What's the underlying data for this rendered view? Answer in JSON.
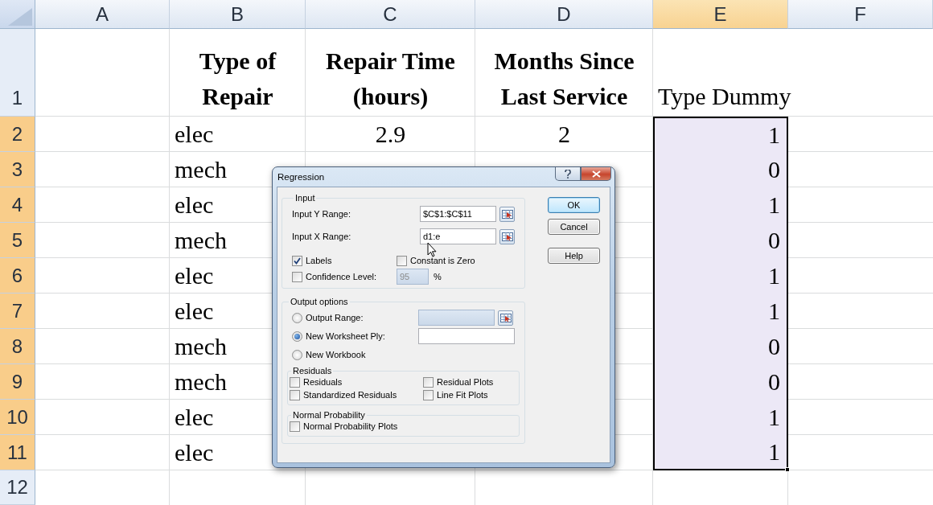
{
  "columns": [
    {
      "label": "A",
      "selected": false
    },
    {
      "label": "B",
      "selected": false
    },
    {
      "label": "C",
      "selected": false
    },
    {
      "label": "D",
      "selected": false
    },
    {
      "label": "E",
      "selected": true
    },
    {
      "label": "F",
      "selected": false
    }
  ],
  "rows": [
    {
      "number": "1",
      "selected": false,
      "kind": "heading",
      "b": "Type of\nRepair",
      "c": "Repair Time\n(hours)",
      "d": "Months Since\nLast Service",
      "e": "Type Dummy"
    },
    {
      "number": "2",
      "selected": true,
      "kind": "data",
      "b": "elec",
      "c": "2.9",
      "d": "2",
      "e": "1"
    },
    {
      "number": "3",
      "selected": true,
      "kind": "data",
      "b": "mech",
      "e": "0"
    },
    {
      "number": "4",
      "selected": true,
      "kind": "data",
      "b": "elec",
      "e": "1"
    },
    {
      "number": "5",
      "selected": true,
      "kind": "data",
      "b": "mech",
      "e": "0"
    },
    {
      "number": "6",
      "selected": true,
      "kind": "data",
      "b": "elec",
      "e": "1"
    },
    {
      "number": "7",
      "selected": true,
      "kind": "data",
      "b": "elec",
      "e": "1"
    },
    {
      "number": "8",
      "selected": true,
      "kind": "data",
      "b": "mech",
      "e": "0"
    },
    {
      "number": "9",
      "selected": true,
      "kind": "data",
      "b": "mech",
      "e": "0"
    },
    {
      "number": "10",
      "selected": true,
      "kind": "data",
      "b": "elec",
      "e": "1"
    },
    {
      "number": "11",
      "selected": true,
      "kind": "data",
      "b": "elec",
      "e": "1"
    },
    {
      "number": "12",
      "selected": false,
      "kind": "data"
    }
  ],
  "dialog": {
    "title": "Regression",
    "input_group": {
      "title": "Input",
      "ranges": [
        {
          "label": "Input Y Range:",
          "value": "$C$1:$C$11"
        },
        {
          "label": "Input X Range:",
          "value": "d1:e"
        }
      ],
      "labels": {
        "label": "Labels",
        "checked": true
      },
      "constant_is_zero": {
        "label": "Constant is Zero",
        "checked": false
      },
      "confidence": {
        "label": "Confidence Level:",
        "checked": false,
        "value": "95",
        "unit": "%",
        "disabled": true
      }
    },
    "output_group": {
      "title": "Output options",
      "destinations": [
        {
          "label": "Output Range:",
          "selected": false,
          "kind": "range",
          "field_disabled": true
        },
        {
          "label": "New Worksheet Ply:",
          "selected": true,
          "kind": "text",
          "field_disabled": false
        },
        {
          "label": "New Workbook",
          "selected": false,
          "kind": "plain"
        }
      ],
      "residuals": {
        "title": "Residuals",
        "options": [
          {
            "label": "Residuals",
            "checked": false
          },
          {
            "label": "Residual Plots",
            "checked": false
          },
          {
            "label": "Standardized Residuals",
            "checked": false
          },
          {
            "label": "Line Fit Plots",
            "checked": false
          }
        ]
      },
      "normal_probability": {
        "title": "Normal Probability",
        "options": [
          {
            "label": "Normal Probability Plots",
            "checked": false
          }
        ]
      }
    },
    "buttons": [
      {
        "label": "OK",
        "default": true
      },
      {
        "label": "Cancel",
        "default": false
      },
      {
        "label": "Help",
        "default": false
      }
    ]
  }
}
